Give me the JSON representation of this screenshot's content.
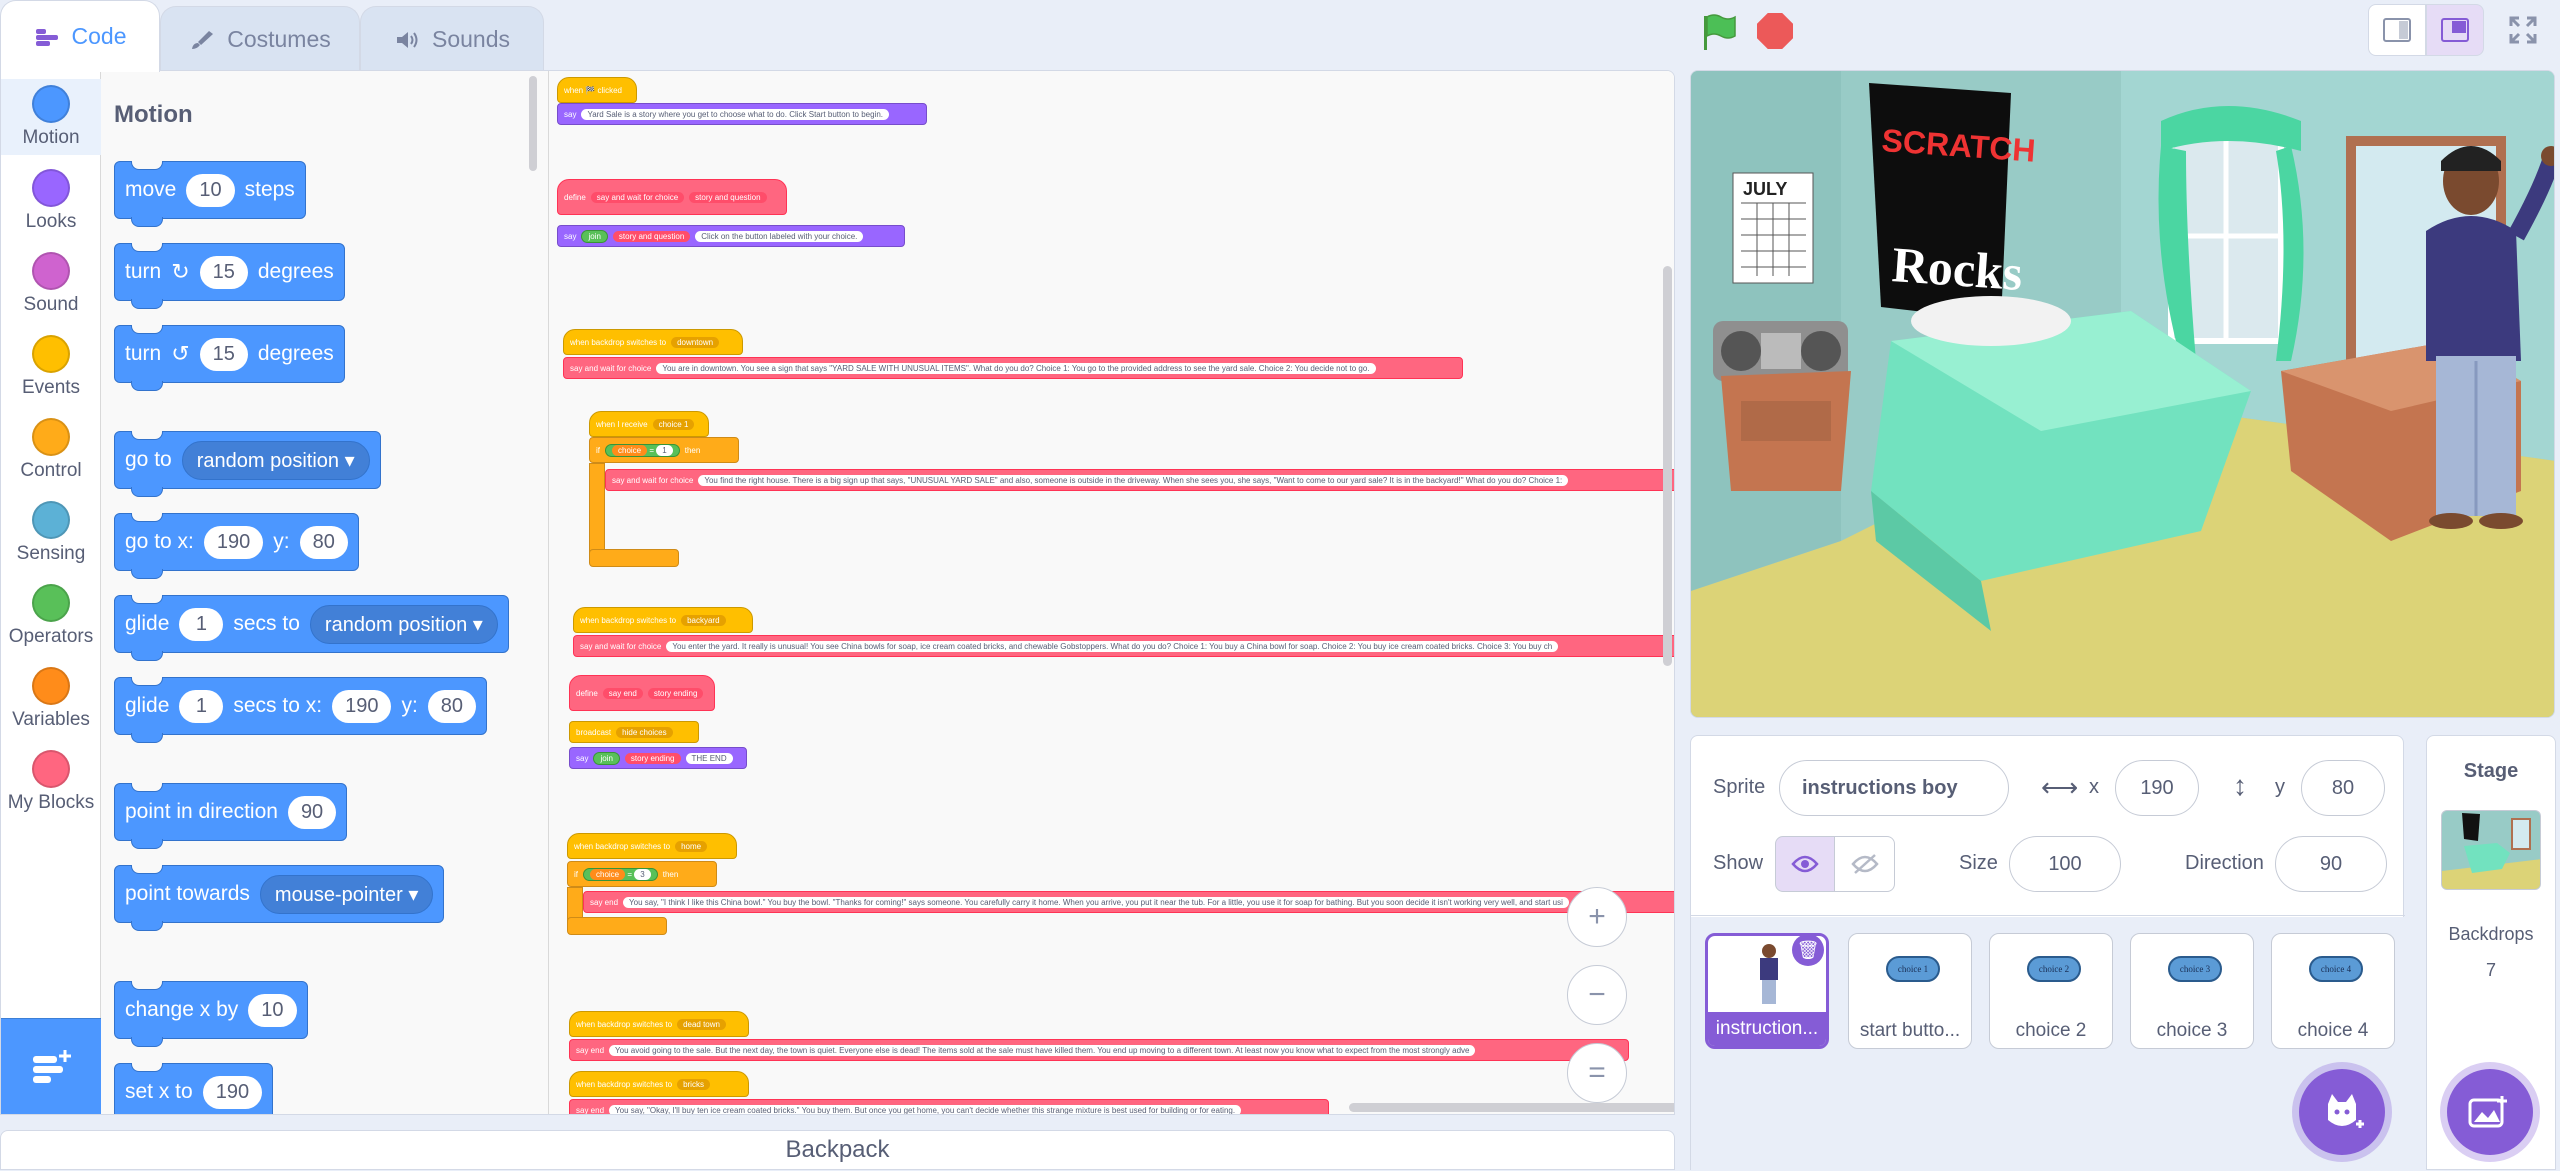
{
  "tabs": [
    {
      "label": "Code",
      "active": true
    },
    {
      "label": "Costumes",
      "active": false
    },
    {
      "label": "Sounds",
      "active": false
    }
  ],
  "categories": [
    {
      "label": "Motion",
      "color": "#4c97ff"
    },
    {
      "label": "Looks",
      "color": "#9966ff"
    },
    {
      "label": "Sound",
      "color": "#cf63cf"
    },
    {
      "label": "Events",
      "color": "#ffbf00"
    },
    {
      "label": "Control",
      "color": "#ffab19"
    },
    {
      "label": "Sensing",
      "color": "#5cb1d6"
    },
    {
      "label": "Operators",
      "color": "#59c059"
    },
    {
      "label": "Variables",
      "color": "#ff8c1a"
    },
    {
      "label": "My Blocks",
      "color": "#ff6680"
    }
  ],
  "palette": {
    "title": "Motion",
    "move": {
      "a": "move",
      "v": "10",
      "b": "steps"
    },
    "turn_right": {
      "a": "turn",
      "v": "15",
      "b": "degrees"
    },
    "turn_left": {
      "a": "turn",
      "v": "15",
      "b": "degrees"
    },
    "goto": {
      "a": "go to",
      "d": "random position"
    },
    "goto_xy": {
      "a": "go to x:",
      "x": "190",
      "b": "y:",
      "y": "80"
    },
    "glide": {
      "a": "glide",
      "v": "1",
      "b": "secs to",
      "d": "random position"
    },
    "glide_xy": {
      "a": "glide",
      "v": "1",
      "b": "secs to x:",
      "x": "190",
      "c": "y:",
      "y": "80"
    },
    "point_dir": {
      "a": "point in direction",
      "v": "90"
    },
    "point_towards": {
      "a": "point towards",
      "d": "mouse-pointer"
    },
    "change_x": {
      "a": "change x by",
      "v": "10"
    },
    "set_x": {
      "a": "set x to",
      "v": "190"
    }
  },
  "scripts": {
    "s1_hat": "when 🏁 clicked",
    "s1_say": "say",
    "s1_text": "Yard Sale is a story where you get to choose what to do. Click Start button to begin.",
    "s2_define": "define",
    "s2_name": "say and wait for choice",
    "s2_arg": "story and question",
    "s2_say": "say",
    "s2_join": "join",
    "s2_text": "Click on the button labeled with your choice.",
    "s3_hat": "when backdrop switches to",
    "s3_drop": "downtown",
    "s3_call": "say and wait for choice",
    "s3_text": "You are in downtown. You see a sign that says \"YARD SALE WITH UNUSUAL ITEMS\". What do you do? Choice 1: You go to the provided address to see the yard sale. Choice 2: You decide not to go.",
    "s4_hat": "when I receive",
    "s4_drop": "choice 1",
    "s4_if": "if",
    "s4_var": "choice",
    "s4_eq": "=",
    "s4_val": "1",
    "s4_then": "then",
    "s4_call": "say and wait for choice",
    "s4_text": "You find the right house. There is a big sign up that says, \"UNUSUAL YARD SALE\" and also, someone is outside in the driveway. When she sees you, she says, \"Want to come to our yard sale? It is in the backyard!\" What do you do? Choice 1:",
    "s5_hat": "when backdrop switches to",
    "s5_drop": "backyard",
    "s5_call": "say and wait for choice",
    "s5_text": "You enter the yard. It really is unusual! You see China bowls for soap, ice cream coated bricks, and chewable Gobstoppers. What do you do? Choice 1: You buy a China bowl for soap. Choice 2: You buy ice cream coated bricks. Choice 3: You buy ch",
    "s6_define": "define",
    "s6_name": "say end",
    "s6_arg": "story ending",
    "s6_bcast": "broadcast",
    "s6_bdrop": "hide choices",
    "s6_say": "say",
    "s6_join": "join",
    "s6_arg2": "story ending",
    "s6_end": "THE END",
    "s7_hat": "when backdrop switches to",
    "s7_drop": "home",
    "s7_if": "if",
    "s7_var": "choice",
    "s7_eq": "=",
    "s7_val": "3",
    "s7_then": "then",
    "s7_call": "say end",
    "s7_text": "You say, \"I think I like this China bowl.\" You buy the bowl. \"Thanks for coming!\" says someone. You carefully carry it home. When you arrive, you put it near the tub. For a little, you use it for soap for bathing. But you soon decide it isn't working very well, and start usi",
    "s8_hat": "when backdrop switches to",
    "s8_drop": "dead town",
    "s8_call": "say end",
    "s8_text": "You avoid going to the sale. But the next day, the town is quiet. Everyone else is dead! The items sold at the sale must have killed them. You end up moving to a different town. At least now you know what to expect from the most strongly adve",
    "s9_hat": "when backdrop switches to",
    "s9_drop": "bricks",
    "s9_call": "say end",
    "s9_text": "You say, \"Okay, I'll buy ten ice cream coated bricks.\" You buy them. But once you get home, you can't decide whether this strange mixture is best used for building or for eating."
  },
  "zoom": {
    "in": "+",
    "out": "−",
    "reset": "="
  },
  "backpack": "Backpack",
  "stage_art": {
    "calendar": "JULY",
    "poster1": "SCRATCH",
    "poster2": "Rocks"
  },
  "sprite_info": {
    "sprite_label": "Sprite",
    "sprite_name": "instructions boy",
    "x_label": "x",
    "x": "190",
    "y_label": "y",
    "y": "80",
    "show_label": "Show",
    "size_label": "Size",
    "size": "100",
    "direction_label": "Direction",
    "direction": "90"
  },
  "sprites": [
    {
      "name": "instruction...",
      "selected": true
    },
    {
      "name": "start butto...",
      "pill": "choice 1"
    },
    {
      "name": "choice 2",
      "pill": "choice 2"
    },
    {
      "name": "choice 3",
      "pill": "choice 3"
    },
    {
      "name": "choice 4",
      "pill": "choice 4"
    }
  ],
  "stage_pane": {
    "title": "Stage",
    "backdrops_label": "Backdrops",
    "backdrops_count": "7"
  },
  "colors": {
    "motion": "#4c97ff",
    "accent": "#855cd6",
    "stage_bg": "#a7d8d3"
  }
}
